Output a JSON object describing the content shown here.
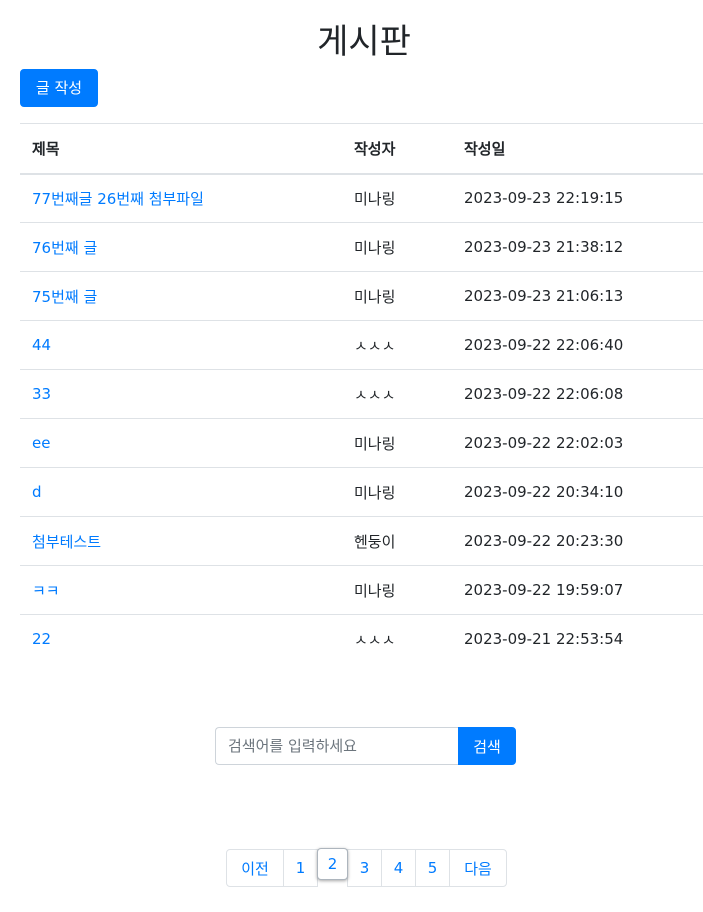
{
  "page": {
    "title": "게시판"
  },
  "toolbar": {
    "write_label": "글 작성"
  },
  "table": {
    "headers": {
      "title": "제목",
      "writer": "작성자",
      "date": "작성일"
    },
    "rows": [
      {
        "title": "77번째글 26번째 첨부파일",
        "writer": "미나링",
        "date": "2023-09-23 22:19:15"
      },
      {
        "title": "76번째 글",
        "writer": "미나링",
        "date": "2023-09-23 21:38:12"
      },
      {
        "title": "75번째 글",
        "writer": "미나링",
        "date": "2023-09-23 21:06:13"
      },
      {
        "title": "44",
        "writer": "ㅅㅅㅅ",
        "date": "2023-09-22 22:06:40"
      },
      {
        "title": "33",
        "writer": "ㅅㅅㅅ",
        "date": "2023-09-22 22:06:08"
      },
      {
        "title": "ee",
        "writer": "미나링",
        "date": "2023-09-22 22:02:03"
      },
      {
        "title": "d",
        "writer": "미나링",
        "date": "2023-09-22 20:34:10"
      },
      {
        "title": "첨부테스트",
        "writer": "헨둥이",
        "date": "2023-09-22 20:23:30"
      },
      {
        "title": "ㅋㅋ",
        "writer": "미나링",
        "date": "2023-09-22 19:59:07"
      },
      {
        "title": "22",
        "writer": "ㅅㅅㅅ",
        "date": "2023-09-21 22:53:54"
      }
    ]
  },
  "search": {
    "placeholder": "검색어를 입력하세요",
    "button_label": "검색"
  },
  "pagination": {
    "prev_label": "이전",
    "next_label": "다음",
    "pages": [
      "1",
      "2",
      "3",
      "4",
      "5"
    ],
    "current": "2"
  },
  "colors": {
    "accent": "#007bff",
    "border": "#dee2e6",
    "text": "#212529"
  }
}
